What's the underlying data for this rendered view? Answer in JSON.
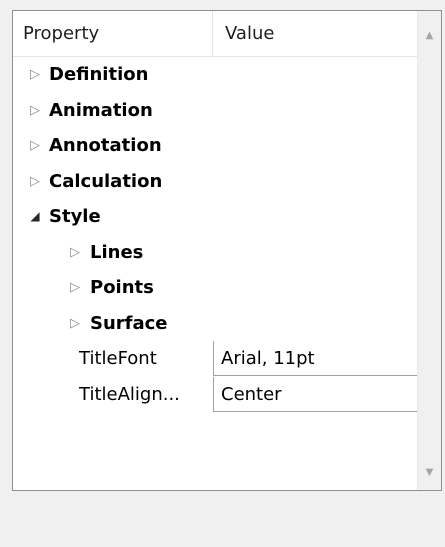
{
  "grid": {
    "header": {
      "property": "Property",
      "value": "Value"
    },
    "categories": [
      {
        "label": "Definition"
      },
      {
        "label": "Animation"
      },
      {
        "label": "Annotation"
      },
      {
        "label": "Calculation"
      },
      {
        "label": "Style"
      }
    ],
    "style_children": [
      {
        "label": "Lines"
      },
      {
        "label": "Points"
      },
      {
        "label": "Surface"
      }
    ],
    "properties": [
      {
        "name": "TitleFont",
        "value": "Arial, 11pt"
      },
      {
        "name": "TitleAlign...",
        "value": "Center"
      }
    ]
  },
  "icons": {
    "collapsed": "triangle-right-icon",
    "expanded": "triangle-down-icon",
    "scroll_up": "chevron-up-icon",
    "scroll_down": "chevron-down-icon"
  },
  "colors": {
    "background": "#f0f0f0",
    "grid_background": "#ffffff",
    "border": "#8e8f8f"
  }
}
